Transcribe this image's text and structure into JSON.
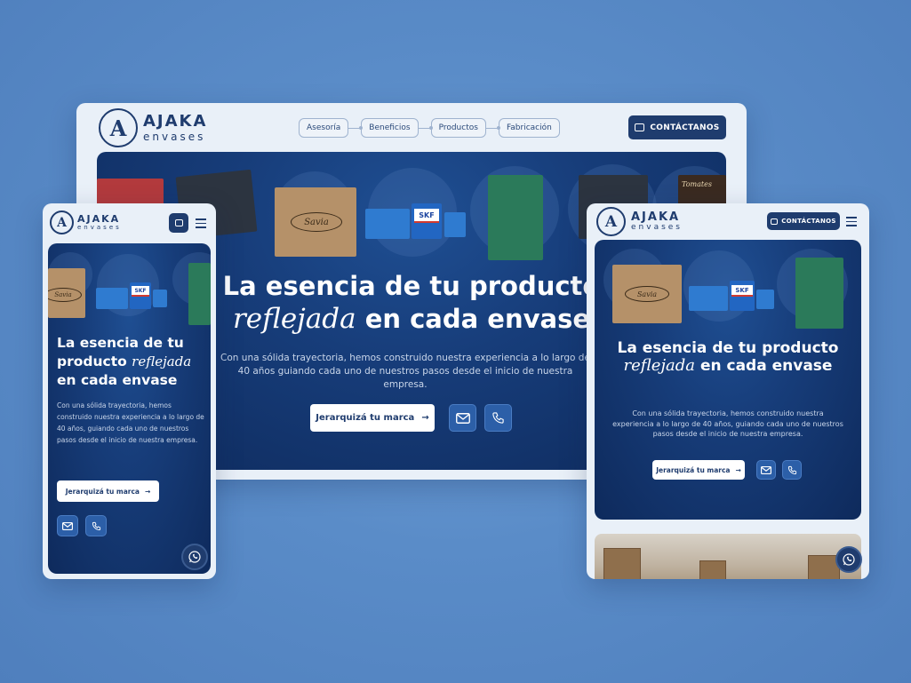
{
  "brand": {
    "name": "AJAKA",
    "sub": "envases",
    "mark": "A"
  },
  "nav": {
    "items": [
      "Asesoría",
      "Beneficios",
      "Productos",
      "Fabricación"
    ]
  },
  "contact_label": "CONTÁCTANOS",
  "hero": {
    "title_line1": "La esencia de tu producto",
    "title_script": "reflejada",
    "title_line2_rest": "en cada envase",
    "mobile_title_a": "La esencia de tu producto",
    "mobile_title_b": "en cada envase",
    "description_desktop": "Con una sólida trayectoria, hemos construido nuestra experiencia a lo largo de 40 años guiando cada uno de nuestros pasos desde el inicio de nuestra empresa.",
    "description": "Con una sólida trayectoria, hemos construido nuestra experiencia a lo largo de 40 años, guiando cada uno de nuestros pasos desde el inicio de nuestra empresa.",
    "cta_label": "Jerarquizá tu marca",
    "cta_arrow": "→"
  },
  "product_labels": {
    "skf": "SKF",
    "bag": "Savia",
    "tomatoes": "Tomates"
  },
  "icons": {
    "mail": "mail-icon",
    "phone": "phone-icon",
    "chat": "chat-icon",
    "menu": "hamburger-icon",
    "whatsapp": "whatsapp-icon",
    "arrow": "arrow-right-icon"
  },
  "colors": {
    "navy": "#1f3c6e",
    "hero_dark": "#0e2a5c",
    "hero_light": "#1f4f93",
    "accent_blue": "#2c5fa8",
    "background": "#5a8cc8"
  }
}
